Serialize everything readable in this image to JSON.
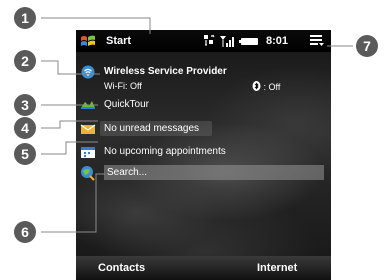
{
  "topbar": {
    "start_label": "Start",
    "time": "8:01",
    "icons": [
      "windows-flag-icon",
      "network-sync-icon",
      "signal-strength-icon",
      "battery-icon",
      "menu-icon"
    ]
  },
  "provider": {
    "name": "Wireless Service Provider",
    "wifi": "Wi-Fi: Off",
    "bluetooth": ": Off"
  },
  "items": {
    "quicktour": "QuickTour",
    "messages": "No unread messages",
    "appointments": "No upcoming appointments",
    "search_placeholder": "Search..."
  },
  "softkeys": {
    "left": "Contacts",
    "right": "Internet"
  },
  "callouts": [
    "1",
    "2",
    "3",
    "4",
    "5",
    "6",
    "7"
  ],
  "colors": {
    "callout_bubble": "#5a5a5a",
    "screen_bg": "#000000",
    "search_box": "#8a8a8a"
  }
}
